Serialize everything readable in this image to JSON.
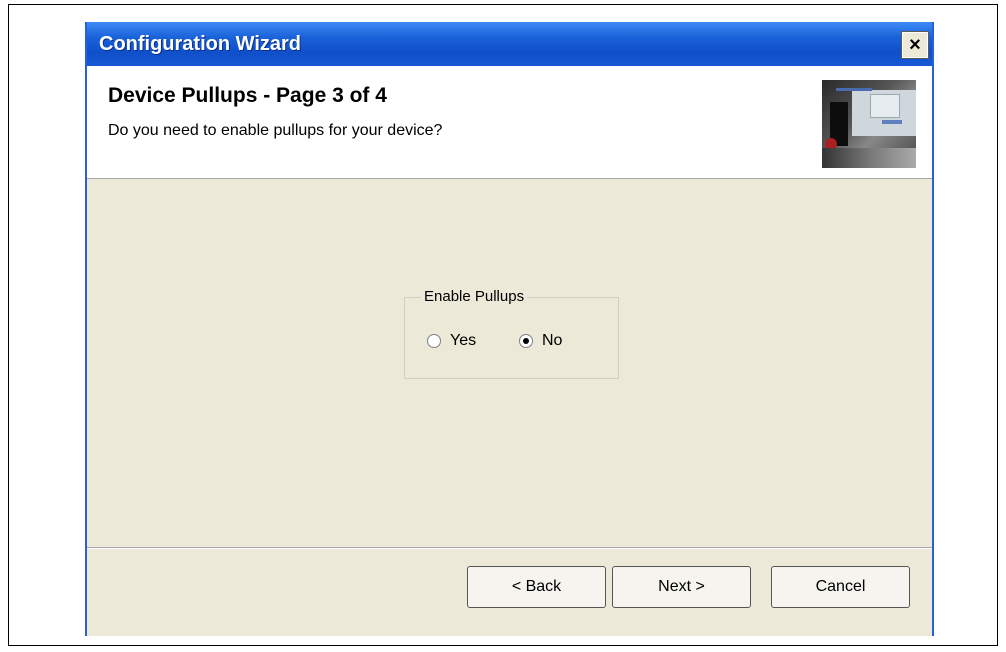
{
  "window": {
    "title": "Configuration Wizard",
    "close_label": "×"
  },
  "header": {
    "title": "Device Pullups  -  Page 3 of 4",
    "subtitle": "Do you need to enable pullups for your device?"
  },
  "options": {
    "legend": "Enable Pullups",
    "yes_label": "Yes",
    "no_label": "No",
    "selected": "No"
  },
  "buttons": {
    "back": "< Back",
    "next": "Next >",
    "cancel": "Cancel"
  },
  "colors": {
    "titlebar": "#0f4fc9",
    "dialog_bg": "#ece9d8"
  },
  "icons": {
    "close": "close-icon",
    "header": "wizard-banner-image"
  }
}
